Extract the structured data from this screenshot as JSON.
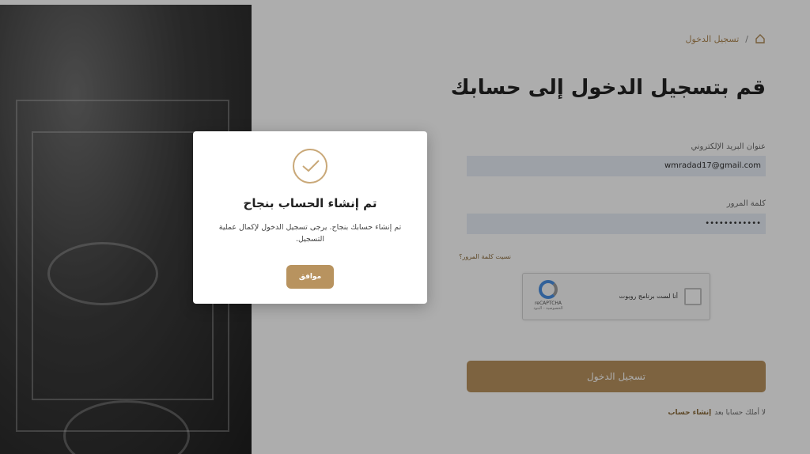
{
  "breadcrumb": {
    "home_icon": "home-icon",
    "separator": "/",
    "current": "تسجيل الدخول"
  },
  "page": {
    "title": "قم بتسجيل الدخول إلى حسابك"
  },
  "form": {
    "email_label": "عنوان البريد الإلكتروني",
    "email_value": "wmradad17@gmail.com",
    "password_label": "كلمة المرور",
    "password_value": "••••••••••••",
    "forgot_password": "نسيت كلمة المرور؟",
    "recaptcha_label": "أنا لست برنامج روبوت",
    "recaptcha_brand": "reCAPTCHA",
    "recaptcha_terms": "الخصوصية - البنود",
    "login_button": "تسجيل الدخول",
    "no_account_text": "لا أملك حسابا بعد",
    "signup_link": "إنشاء حساب"
  },
  "modal": {
    "icon": "check-icon",
    "title": "تم إنشاء الحساب بنجاح",
    "message": "تم إنشاء حسابك بنجاح. يرجى تسجيل الدخول لإكمال عملية التسجيل.",
    "ok_button": "موافق"
  },
  "colors": {
    "accent": "#b8935f",
    "input_bg": "#e8edf7",
    "overlay": "rgba(0,0,0,0.32)"
  }
}
